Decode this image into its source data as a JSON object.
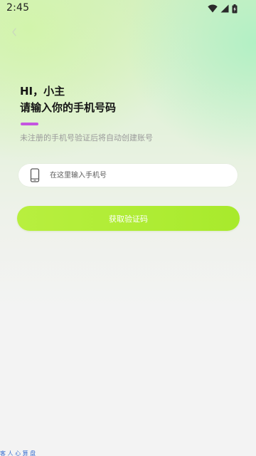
{
  "status_bar": {
    "time": "2:45",
    "icons": [
      "wifi-icon",
      "signal-icon",
      "battery-icon"
    ]
  },
  "nav": {
    "back_icon": "chevron-left-icon"
  },
  "content": {
    "greeting": "HI，小主",
    "headline": "请输入你的手机号码",
    "hint": "未注册的手机号验证后将自动创建账号"
  },
  "phone_field": {
    "icon": "smartphone-icon",
    "placeholder": "在这里输入手机号",
    "value": ""
  },
  "submit_button": {
    "label": "获取验证码"
  },
  "footer_fragment": {
    "text": "客 人 心 算 盘"
  },
  "colors": {
    "accent": "#c455e0",
    "button": "#aeea34",
    "text_primary": "#141414",
    "text_hint": "#9a9a9a"
  }
}
